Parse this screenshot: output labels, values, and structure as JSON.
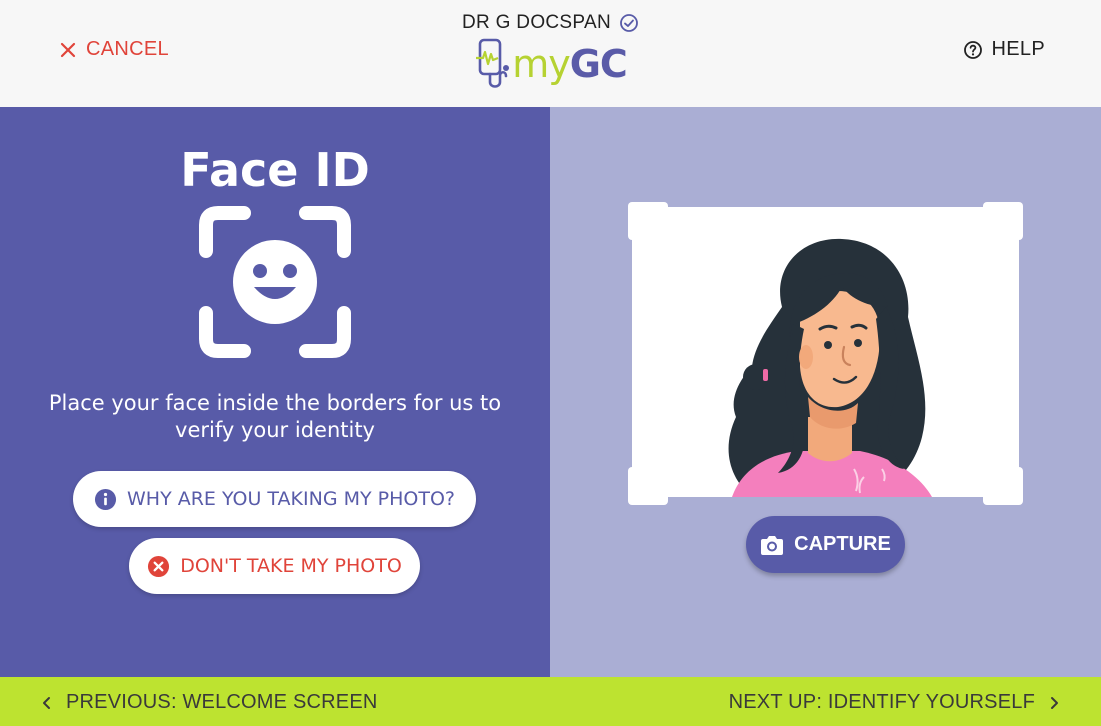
{
  "header": {
    "cancel_label": "CANCEL",
    "help_label": "HELP",
    "doctor_name": "DR G DOCSPAN",
    "logo_my": "my",
    "logo_gc": "GC"
  },
  "left_panel": {
    "title": "Face ID",
    "instruction": "Place your face inside the borders for us to verify your identity",
    "why_button": "WHY ARE YOU TAKING MY PHOTO?",
    "dont_button": "DON'T TAKE MY PHOTO"
  },
  "right_panel": {
    "capture_label": "CAPTURE"
  },
  "footer": {
    "previous_label": "PREVIOUS: WELCOME SCREEN",
    "next_label": "NEXT UP: IDENTIFY YOURSELF"
  },
  "colors": {
    "brand_purple": "#585ba8",
    "panel_light": "#aaaed4",
    "footer_green": "#bde330",
    "cancel_red": "#e0443a"
  },
  "icons": [
    "close-icon",
    "help-circle-icon",
    "verified-check-icon",
    "stethoscope-phone-icon",
    "face-id-icon",
    "info-icon",
    "cancel-circle-icon",
    "camera-icon",
    "chevron-left-icon",
    "chevron-right-icon"
  ]
}
